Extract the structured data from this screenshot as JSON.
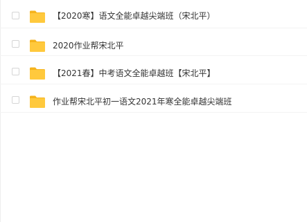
{
  "file_list": {
    "items": [
      {
        "name": "【2020寒】语文全能卓越尖端班（宋北平）",
        "icon": "folder-icon",
        "type": "folder"
      },
      {
        "name": "2020作业帮宋北平",
        "icon": "folder-icon",
        "type": "folder"
      },
      {
        "name": "【2021春】中考语文全能卓越班【宋北平】",
        "icon": "folder-icon",
        "type": "folder"
      },
      {
        "name": "作业帮宋北平初一语文2021年寒全能卓越尖端班",
        "icon": "folder-icon",
        "type": "folder"
      }
    ]
  },
  "colors": {
    "folder_body": "#ffc93d",
    "folder_tab": "#f5b31c",
    "text": "#333333",
    "checkbox_border": "#d5d5d5",
    "row_divider": "#f3f3f3"
  }
}
